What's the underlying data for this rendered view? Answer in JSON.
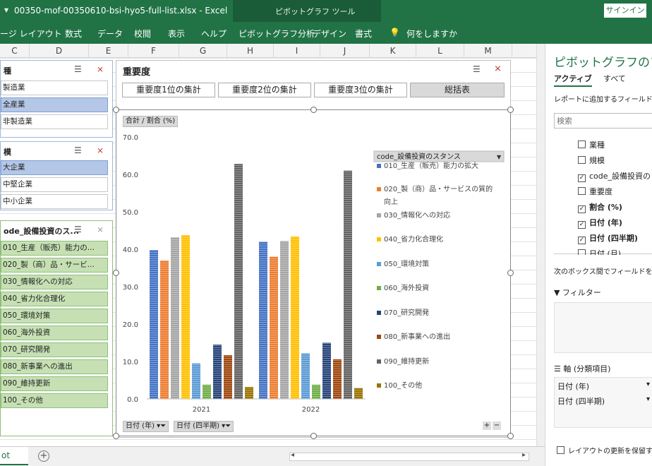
{
  "title_bar": {
    "doc_title": "00350-mof-00350610-bsi-hyo5-full-list.xlsx  -  Excel",
    "context_tools": "ピボットグラフ ツール",
    "signin": "サインイン"
  },
  "ribbon_tabs": [
    "ージ レイアウト",
    "数式",
    "データ",
    "校閲",
    "表示",
    "ヘルプ",
    "ピボットグラフ分析",
    "デザイン",
    "書式",
    "何をしますか"
  ],
  "columns": [
    "C",
    "D",
    "E",
    "F",
    "G",
    "H",
    "I",
    "J",
    "K",
    "L",
    "M"
  ],
  "slicers": {
    "industry": {
      "header": "種",
      "items": [
        "製造業",
        "全産業",
        "非製造業"
      ],
      "selected": 1
    },
    "scale": {
      "header": "模",
      "items": [
        "大企業",
        "中堅企業",
        "中小企業"
      ],
      "selected": 0
    },
    "stance": {
      "header": "ode_設備投資のス...",
      "items": [
        "010_生産（販売）能力の...",
        "020_製（商）品・サービ...",
        "030_情報化への対応",
        "040_省力化合理化",
        "050_環境対策",
        "060_海外投資",
        "070_研究開発",
        "080_新事業への進出",
        "090_維持更新",
        "100_その他"
      ]
    }
  },
  "chart_panel": {
    "header": "重要度",
    "buttons": [
      "重要度1位の集計",
      "重要度2位の集計",
      "重要度3位の集計",
      "総括表"
    ],
    "value_field": "合計 / 割合 (%)",
    "axis_fields": [
      "日付 (年)",
      "日付 (四半期)"
    ],
    "legend_title": "code_設備投資のスタンス"
  },
  "chart_data": {
    "type": "bar",
    "categories": [
      "2021",
      "2022"
    ],
    "ylim": [
      0,
      70
    ],
    "yticks": [
      "0.0",
      "10.0",
      "20.0",
      "30.0",
      "40.0",
      "50.0",
      "60.0",
      "70.0"
    ],
    "series": [
      {
        "name": "010_生産（販売）能力の拡大",
        "color": "#4472c4",
        "values": [
          39.8,
          42.0
        ]
      },
      {
        "name": "020_製（商）品・サービスの質的向上",
        "color": "#ed7d31",
        "values": [
          37.0,
          38.0
        ]
      },
      {
        "name": "030_情報化への対応",
        "color": "#a5a5a5",
        "values": [
          43.2,
          42.2
        ]
      },
      {
        "name": "040_省力化合理化",
        "color": "#ffc000",
        "values": [
          43.8,
          43.4
        ]
      },
      {
        "name": "050_環境対策",
        "color": "#5b9bd5",
        "values": [
          9.5,
          12.2
        ]
      },
      {
        "name": "060_海外投資",
        "color": "#70ad47",
        "values": [
          3.8,
          3.8
        ]
      },
      {
        "name": "070_研究開発",
        "color": "#264478",
        "values": [
          14.5,
          15.0
        ]
      },
      {
        "name": "080_新事業への進出",
        "color": "#9e480e",
        "values": [
          11.7,
          10.6
        ]
      },
      {
        "name": "090_維持更新",
        "color": "#636363",
        "values": [
          62.8,
          61.0
        ]
      },
      {
        "name": "100_その他",
        "color": "#997300",
        "values": [
          3.2,
          2.9
        ]
      }
    ]
  },
  "field_pane": {
    "title": "ピボットグラフのフィ",
    "tabs": [
      "アクティブ",
      "すべて"
    ],
    "hint": "レポートに追加するフィールドを選",
    "search_placeholder": "検索",
    "fields": [
      {
        "label": "業種",
        "checked": false
      },
      {
        "label": "規模",
        "checked": false
      },
      {
        "label": "code_設備投資の",
        "checked": true
      },
      {
        "label": "重要度",
        "checked": false
      },
      {
        "label": "割合 (%)",
        "checked": true
      },
      {
        "label": "日付 (年)",
        "checked": true
      },
      {
        "label": "日付 (四半期)",
        "checked": true
      },
      {
        "label": "日付 (月)",
        "checked": false
      }
    ],
    "drag_hint": "次のボックス間でフィールドをドラ",
    "filter_label": "フィルター",
    "axis_label": "軸 (分類項目)",
    "axis_items": [
      "日付 (年)",
      "日付 (四半期)"
    ],
    "defer_label": "レイアウトの更新を保留す"
  },
  "sheet_tab": "ot"
}
